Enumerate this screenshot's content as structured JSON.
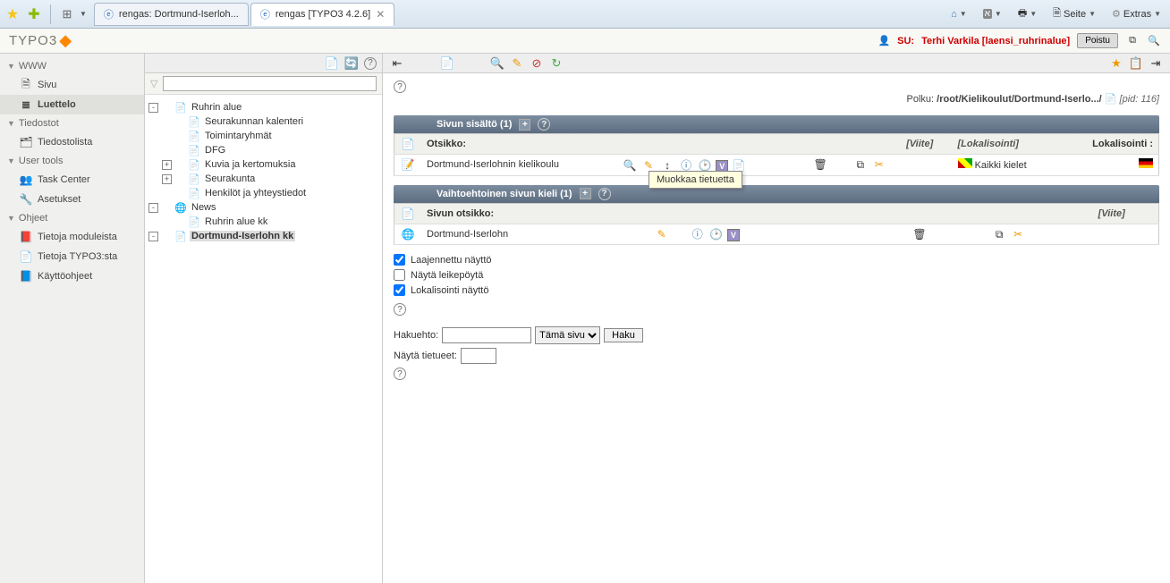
{
  "browser": {
    "tabs": [
      {
        "favicon": "ie",
        "label": "rengas: Dortmund-Iserloh..."
      },
      {
        "favicon": "ie",
        "label": "rengas [TYPO3 4.2.6]",
        "active": true
      }
    ],
    "menu": {
      "seite": "Seite",
      "extras": "Extras"
    }
  },
  "typo3": {
    "logo": "TYPO3",
    "su_label": "SU:",
    "su_user": "Terhi Varkila [laensi_ruhrinalue]",
    "logout": "Poistu"
  },
  "modules": {
    "www": {
      "label": "WWW",
      "items": [
        {
          "key": "sivu",
          "label": "Sivu",
          "icon": "🗎"
        },
        {
          "key": "luettelo",
          "label": "Luettelo",
          "icon": "≣",
          "active": true
        }
      ]
    },
    "tiedostot": {
      "label": "Tiedostot",
      "items": [
        {
          "key": "tiedostolista",
          "label": "Tiedostolista",
          "icon": "🗂"
        }
      ]
    },
    "usertools": {
      "label": "User tools",
      "items": [
        {
          "key": "taskcenter",
          "label": "Task Center",
          "icon": "👥"
        },
        {
          "key": "asetukset",
          "label": "Asetukset",
          "icon": "🔧"
        }
      ]
    },
    "ohjeet": {
      "label": "Ohjeet",
      "items": [
        {
          "key": "modinfo",
          "label": "Tietoja moduleista",
          "icon": "📕"
        },
        {
          "key": "t3info",
          "label": "Tietoja TYPO3:sta",
          "icon": "📄"
        },
        {
          "key": "manual",
          "label": "Käyttöohjeet",
          "icon": "📘"
        }
      ]
    }
  },
  "tree": [
    {
      "level": 0,
      "toggle": "-",
      "icon": "📄",
      "label": "Ruhrin alue"
    },
    {
      "level": 1,
      "toggle": "",
      "icon": "📄",
      "label": "Seurakunnan kalenteri"
    },
    {
      "level": 1,
      "toggle": "",
      "icon": "📄",
      "label": "Toimintaryhmät"
    },
    {
      "level": 1,
      "toggle": "",
      "icon": "📄",
      "label": "DFG"
    },
    {
      "level": 1,
      "toggle": "+",
      "icon": "📄",
      "label": "Kuvia ja kertomuksia"
    },
    {
      "level": 1,
      "toggle": "+",
      "icon": "📄",
      "label": "Seurakunta"
    },
    {
      "level": 1,
      "toggle": "",
      "icon": "📄",
      "label": "Henkilöt ja yhteystiedot"
    },
    {
      "level": 0,
      "toggle": "-",
      "icon": "🌐",
      "label": "News"
    },
    {
      "level": 1,
      "toggle": "",
      "icon": "📄",
      "label": "Ruhrin alue kk"
    },
    {
      "level": 0,
      "toggle": "-",
      "icon": "📄",
      "label": "Dortmund-Iserlohn kk",
      "selected": true
    }
  ],
  "path": {
    "label": "Polku:",
    "value": "/root/Kielikoulut/Dortmund-Iserlo.../",
    "pid_label": "[pid: 116]"
  },
  "section1": {
    "title": "Sivun sisältö (1)",
    "col_title": "Otsikko:",
    "col_ref": "[Viite]",
    "col_loc": "[Lokalisointi]",
    "col_loc2": "Lokalisointi :",
    "row": {
      "title": "Dortmund-Iserlohnin kielikoulu",
      "lang": "Kaikki kielet"
    }
  },
  "section2": {
    "title": "Vaihtoehtoinen sivun kieli (1)",
    "col_title": "Sivun otsikko:",
    "col_ref": "[Viite]",
    "row": {
      "title": "Dortmund-Iserlohn"
    }
  },
  "tooltip": "Muokkaa tietuetta",
  "options": {
    "extended": "Laajennettu näyttö",
    "clipboard": "Näytä leikepöytä",
    "localization": "Lokalisointi näyttö"
  },
  "search": {
    "label": "Hakuehto:",
    "scope": "Tämä sivu",
    "button": "Haku",
    "show_records": "Näytä tietueet:"
  }
}
